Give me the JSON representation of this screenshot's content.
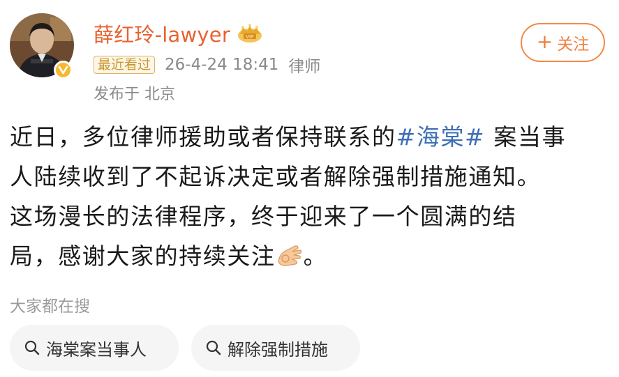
{
  "author": {
    "name": "薛红玲-lawyer",
    "recent_tag": "最近看过",
    "timestamp": "26-4-24 18:41",
    "role": "律师",
    "location": "发布于 北京",
    "avatar_icon": "avatar-photo",
    "verified_icon": "verified-v-badge",
    "member_icon": "crown-icon"
  },
  "follow_button": {
    "plus": "+",
    "label": "关注"
  },
  "post": {
    "line1_pre": "近日，多位律师援助或者保持联系的",
    "hashtag": "#海棠#",
    "line1_post": " 案当事",
    "line2": "人陆续收到了不起诉决定或者解除强制措施通知。",
    "line3": "这场漫长的法律程序，终于迎来了一个圆满的结",
    "line4_pre": "局，感谢大家的持续关注",
    "line4_emoji": "ok-hand",
    "line4_post": "。"
  },
  "search": {
    "title": "大家都在搜",
    "chips": [
      {
        "label": "海棠案当事人",
        "icon": "search-icon"
      },
      {
        "label": "解除强制措施",
        "icon": "search-icon"
      }
    ]
  },
  "colors": {
    "accent_orange": "#e8622f",
    "hashtag_blue": "#3d6fb5",
    "meta_gray": "#8a8a8a",
    "tag_gold": "#c8962c"
  }
}
